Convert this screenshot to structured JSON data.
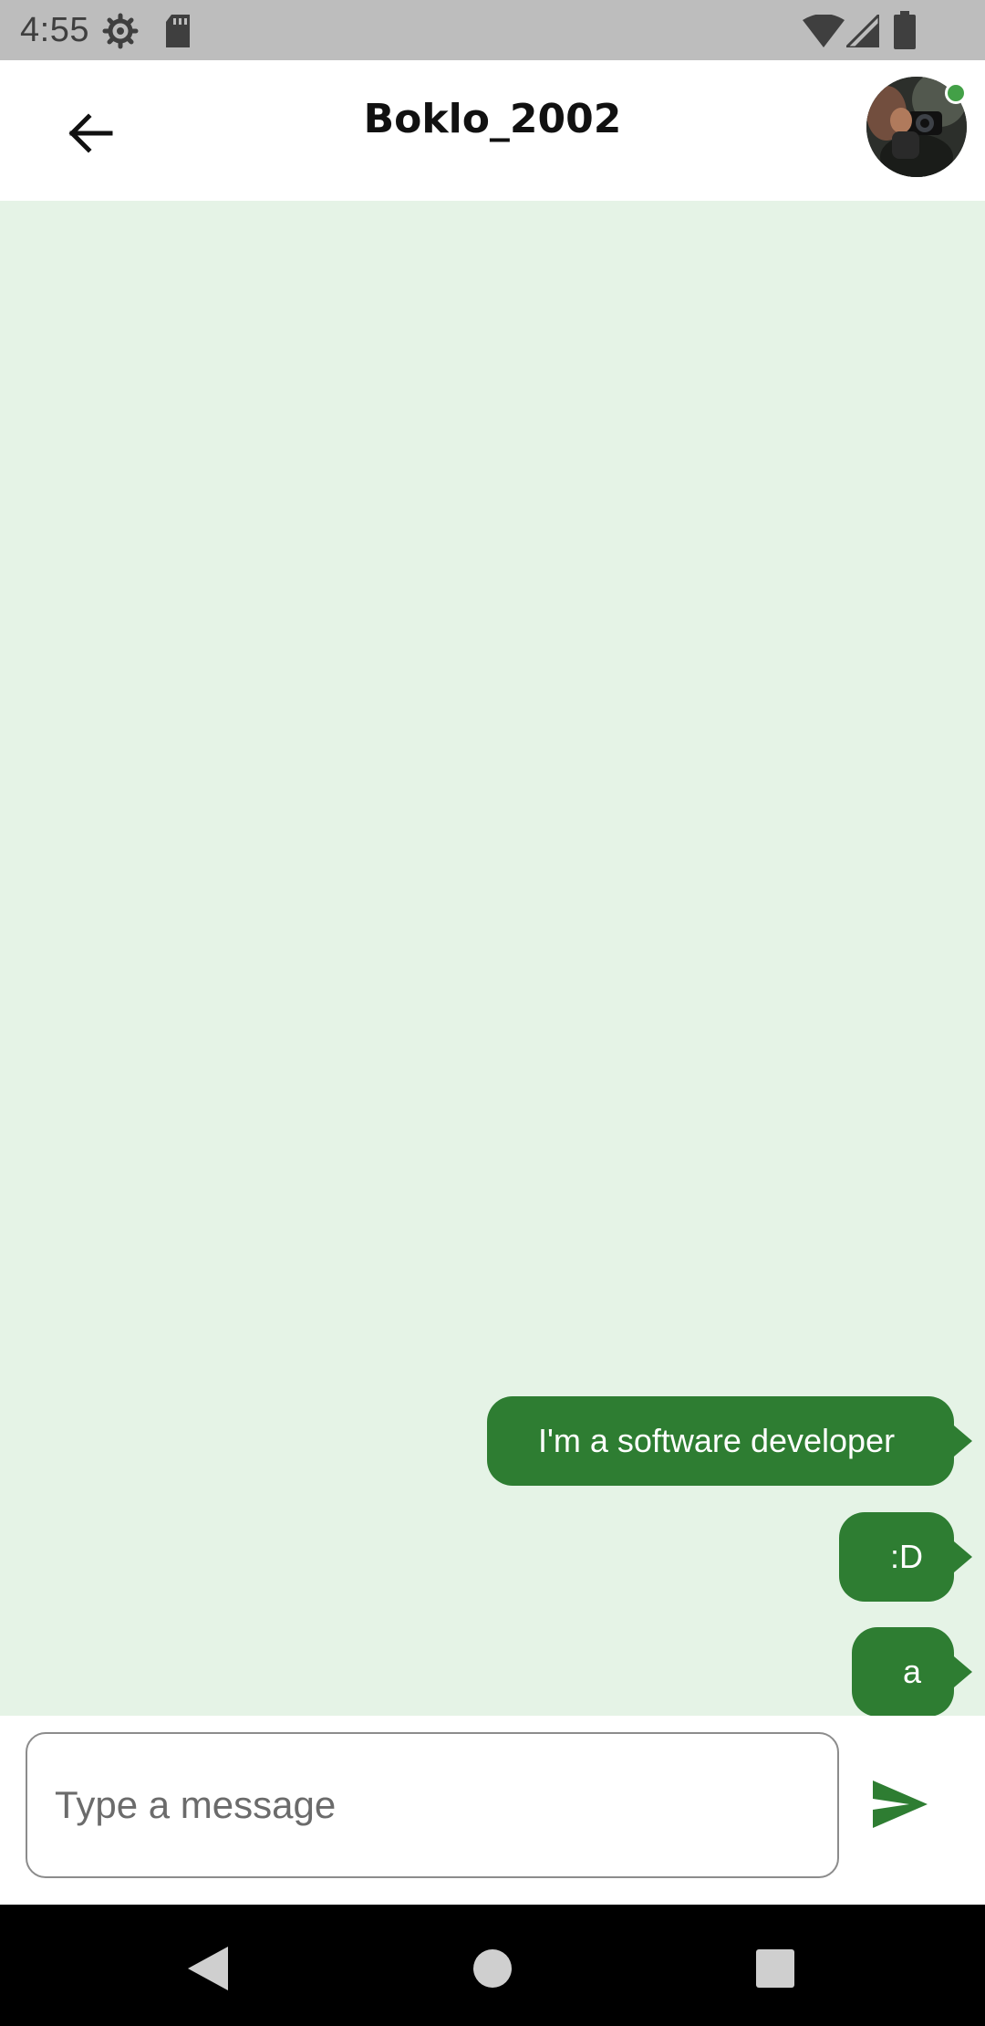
{
  "status_bar": {
    "time": "4:55",
    "icons": [
      "settings-gear-icon",
      "sd-card-icon",
      "wifi-icon",
      "cellular-signal-icon",
      "battery-icon"
    ]
  },
  "header": {
    "title": "Boklo_2002",
    "back_icon": "arrow-back-icon",
    "avatar_status": "online",
    "online_color": "#43a047"
  },
  "chat": {
    "background": "#e5f3e6",
    "bubble_color": "#2e7d32",
    "messages": [
      {
        "text": "I'm a software developer",
        "direction": "outgoing"
      },
      {
        "text": ":D",
        "direction": "outgoing"
      },
      {
        "text": "a",
        "direction": "outgoing"
      }
    ]
  },
  "composer": {
    "placeholder": "Type a message",
    "value": "",
    "send_icon": "send-icon"
  },
  "nav_bar": {
    "buttons": [
      "back-triangle-icon",
      "home-circle-icon",
      "recents-square-icon"
    ]
  }
}
